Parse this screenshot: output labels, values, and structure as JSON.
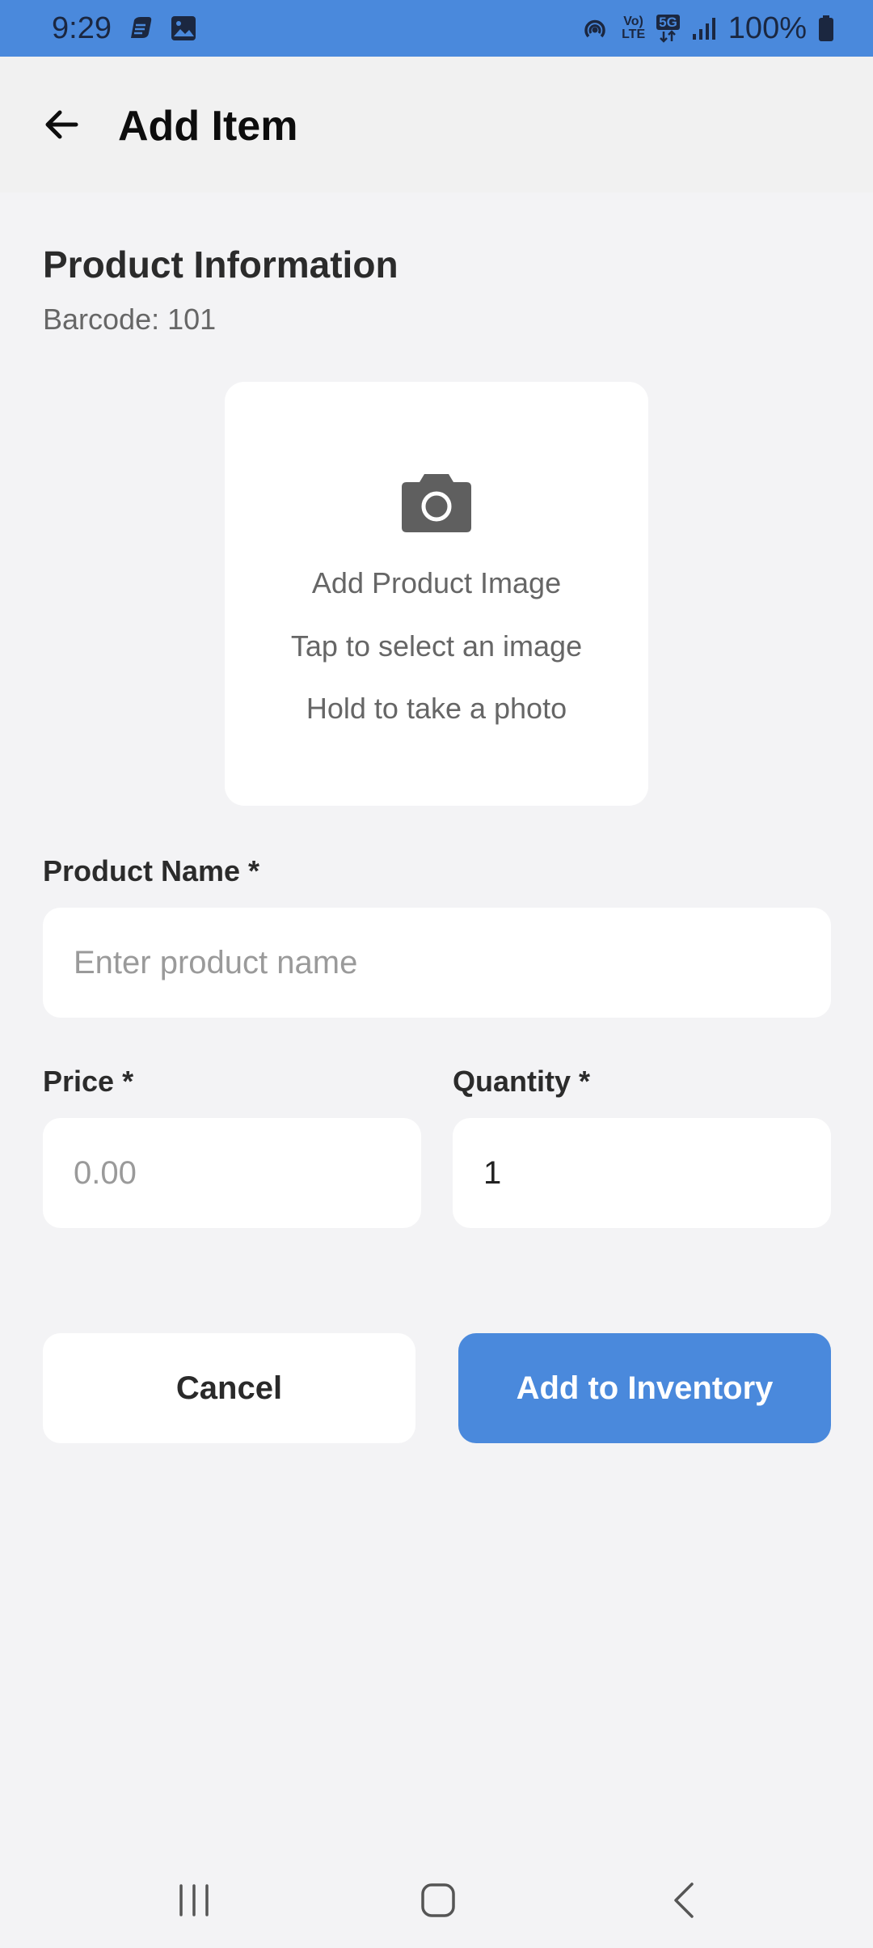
{
  "status_bar": {
    "time": "9:29",
    "battery": "100%",
    "network_label_top": "Vo)",
    "network_label_bottom": "LTE",
    "network_5g": "5G",
    "left_icons": [
      "messenger-icon",
      "gallery-icon"
    ],
    "right_icons": [
      "hotspot-icon",
      "volte-icon",
      "5g-icon",
      "signal-icon",
      "battery-icon"
    ],
    "color": "#4a89dc"
  },
  "app_bar": {
    "title": "Add Item",
    "back_icon": "arrow-left-icon"
  },
  "form": {
    "section_title": "Product Information",
    "barcode": "Barcode: 101",
    "image_picker": {
      "icon": "camera-icon",
      "title": "Add Product Image",
      "hint_tap": "Tap to select an image",
      "hint_hold": "Hold to take a photo"
    },
    "product_name": {
      "label": "Product Name *",
      "placeholder": "Enter product name",
      "value": ""
    },
    "price": {
      "label": "Price *",
      "placeholder": "0.00",
      "value": ""
    },
    "quantity": {
      "label": "Quantity *",
      "value": "1"
    }
  },
  "actions": {
    "cancel_label": "Cancel",
    "add_label": "Add to Inventory",
    "accent_color": "#4a89dc"
  },
  "nav_bar": {
    "recents_icon": "recents-icon",
    "home_icon": "home-icon",
    "back_icon": "back-chevron-icon"
  }
}
